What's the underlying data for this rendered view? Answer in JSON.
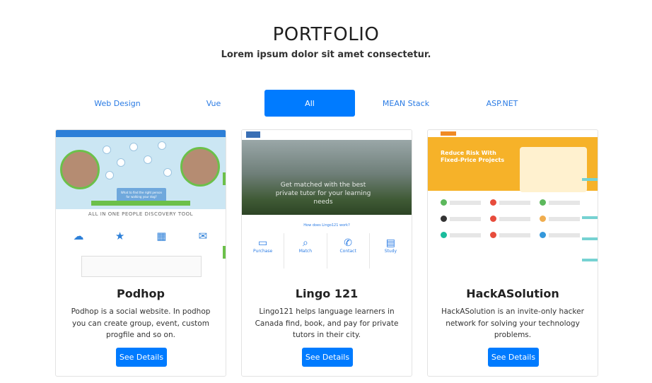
{
  "header": {
    "title": "PORTFOLIO",
    "subtitle": "Lorem ipsum dolor sit amet consectetur."
  },
  "tabs": [
    {
      "label": "Web Design",
      "active": false
    },
    {
      "label": "Vue",
      "active": false
    },
    {
      "label": "All",
      "active": true
    },
    {
      "label": "MEAN Stack",
      "active": false
    },
    {
      "label": "ASP.NET",
      "active": false
    }
  ],
  "projects": [
    {
      "title": "Podhop",
      "description": "Podhop is a social website. In podhop you can create group, event, custom progfile and so on.",
      "button": "See Details",
      "thumbnail_text": {
        "hero_box": "What to find the right person for walking your dog?",
        "tagline": "ALL IN ONE PEOPLE DISCOVERY TOOL"
      }
    },
    {
      "title": "Lingo 121",
      "description": "Lingo121 helps language learners in Canada find, book, and pay for private tutors in their city.",
      "button": "See Details",
      "thumbnail_text": {
        "hero": "Get matched with the best private tutor for your learning needs",
        "how": "How does Lingo121 work?",
        "steps": [
          "Purchase",
          "Match",
          "Contact",
          "Study"
        ]
      }
    },
    {
      "title": "HackASolution",
      "description": "HackASolution is an invite-only hacker network for solving your technology problems.",
      "button": "See Details",
      "thumbnail_text": {
        "hero": "Reduce Risk With Fixed-Price Projects"
      }
    }
  ],
  "colors": {
    "primary": "#007bff",
    "link": "#2a7be4"
  }
}
